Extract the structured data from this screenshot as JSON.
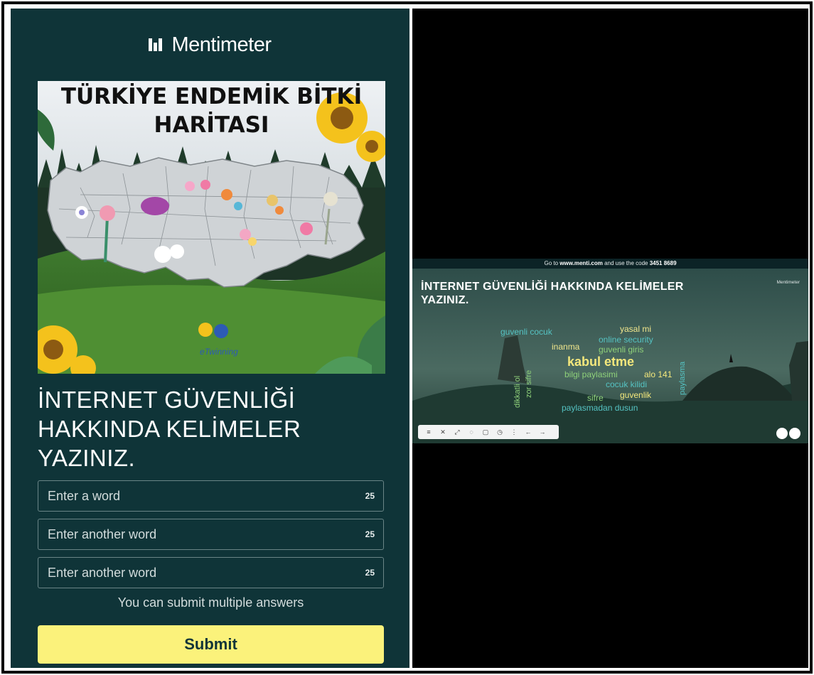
{
  "app": {
    "brand_name": "Mentimeter"
  },
  "poster": {
    "title_line1": "TÜRKİYE ENDEMİK BİTKİ",
    "title_line2": "HARİTASI",
    "badge": "eTwinning"
  },
  "question": {
    "line1": "İNTERNET GÜVENLİĞİ",
    "line2": "HAKKINDA KELİMELER",
    "line3": "YAZINIZ."
  },
  "inputs": [
    {
      "placeholder": "Enter a word",
      "counter": "25"
    },
    {
      "placeholder": "Enter another word",
      "counter": "25"
    },
    {
      "placeholder": "Enter another word",
      "counter": "25"
    }
  ],
  "hint": "You can submit multiple answers",
  "submit_label": "Submit",
  "presentation": {
    "topbar_prefix": "Go to ",
    "topbar_url": "www.menti.com",
    "topbar_middle": " and use the code ",
    "topbar_code": "3451 8689",
    "title_line1": "İNTERNET GÜVENLİĞİ HAKKINDA KELİMELER",
    "title_line2": "YAZINIZ.",
    "brand": "Mentimeter",
    "words": [
      {
        "text": "guvenli cocuk",
        "color": "#55c3c3"
      },
      {
        "text": "yasal mi",
        "color": "#f0e68c"
      },
      {
        "text": "online security",
        "color": "#55c3c3"
      },
      {
        "text": "inanma",
        "color": "#f0e68c"
      },
      {
        "text": "guvenli giris",
        "color": "#8fd17a"
      },
      {
        "text": "kabul etme",
        "color": "#f4e87c"
      },
      {
        "text": "bilgi paylasimi",
        "color": "#8fd17a"
      },
      {
        "text": "alo 141",
        "color": "#f4e87c"
      },
      {
        "text": "cocuk kilidi",
        "color": "#55c3c3"
      },
      {
        "text": "sifre",
        "color": "#8fd17a"
      },
      {
        "text": "guvenlik",
        "color": "#f4e87c"
      },
      {
        "text": "paylasmadan dusun",
        "color": "#55c3c3"
      },
      {
        "text": "dikkatli ol",
        "color": "#8fd17a"
      },
      {
        "text": "zor sifre",
        "color": "#8fd17a"
      },
      {
        "text": "paylasma",
        "color": "#55c3c3"
      }
    ],
    "toolbar_icons": [
      "menu-icon",
      "close-icon",
      "expand-icon",
      "hide-icon",
      "lock-icon",
      "timer-icon",
      "more-icon",
      "back-icon",
      "forward-icon"
    ]
  },
  "colors": {
    "phone_bg": "#0f3438",
    "submit_bg": "#fbf27b",
    "submit_text": "#0f3438",
    "input_border": "#6a8587"
  }
}
